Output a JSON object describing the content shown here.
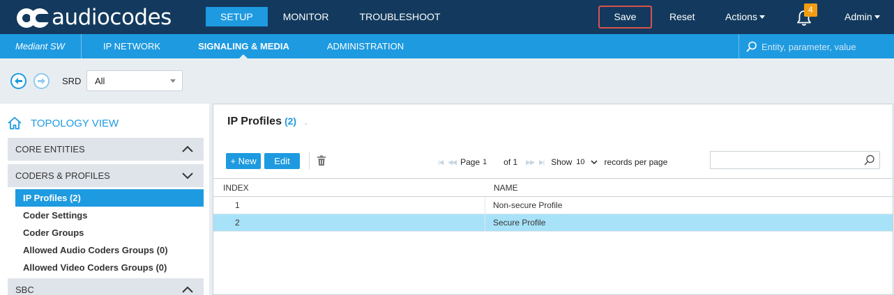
{
  "brand": {
    "logo_text": "audiocodes"
  },
  "topnav": {
    "items": [
      "SETUP",
      "MONITOR",
      "TROUBLESHOOT"
    ],
    "active": "SETUP"
  },
  "header_actions": {
    "save": "Save",
    "reset": "Reset",
    "actions": "Actions",
    "notifications_count": "4",
    "admin": "Admin"
  },
  "subnav": {
    "product": "Mediant SW",
    "items": [
      "IP NETWORK",
      "SIGNALING & MEDIA",
      "ADMINISTRATION"
    ],
    "active": "SIGNALING & MEDIA",
    "search_placeholder": "Entity, parameter, value"
  },
  "srd": {
    "label": "SRD",
    "value": "All"
  },
  "sidebar": {
    "topology": "TOPOLOGY VIEW",
    "sections": [
      "CORE ENTITIES",
      "CODERS & PROFILES",
      "SBC"
    ],
    "items": [
      "IP Profiles (2)",
      "Coder Settings",
      "Coder Groups",
      "Allowed Audio Coders Groups (0)",
      "Allowed Video Coders Groups (0)"
    ],
    "selected": "IP Profiles (2)"
  },
  "main": {
    "title": "IP Profiles",
    "count": "(2)",
    "title_suffix": ".",
    "new_label": "+ New",
    "edit_label": "Edit",
    "pager": {
      "page_label": "Page",
      "page_value": "1",
      "of_label": "of 1",
      "show_label": "Show",
      "show_value": "10",
      "records_label": "records per page"
    },
    "table": {
      "columns": [
        "INDEX",
        "NAME"
      ],
      "rows": [
        {
          "index": "1",
          "name": "Non-secure Profile"
        },
        {
          "index": "2",
          "name": "Secure Profile"
        }
      ],
      "selected_row": 1
    }
  },
  "colors": {
    "topbar": "#133a5e",
    "accent": "#1e9ae0",
    "save_outline": "#d9534f",
    "badge": "#f39c12",
    "selected_row": "#a8e2f8"
  }
}
